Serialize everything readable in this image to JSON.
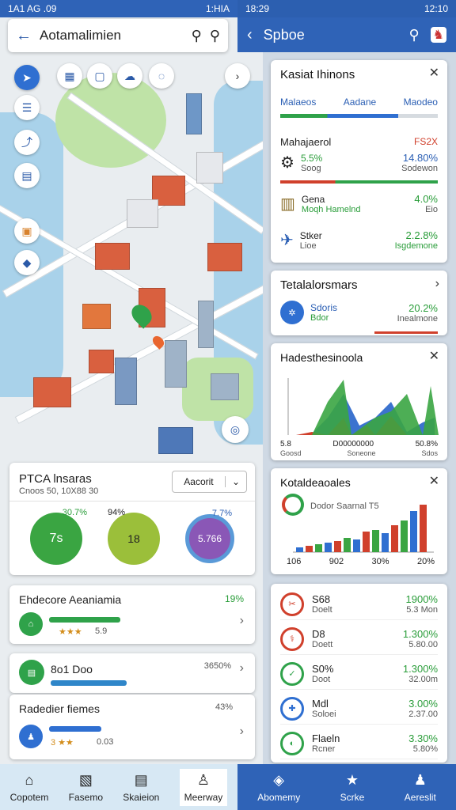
{
  "status_left": {
    "time": "1A1 AG .09",
    "right": "1:HIA"
  },
  "status_right": {
    "time": "18:29",
    "right": "12:10"
  },
  "search": {
    "title": "Aotamalimien"
  },
  "right_header": {
    "title": "Spboe"
  },
  "map_card": {
    "title": "PTCA lnsaras",
    "subtitle": "Cnoos 50, 10X88 30",
    "dropdown": "Aacorit",
    "gauges": [
      {
        "label": "30.7%",
        "value": "7s",
        "color": "#3aa542"
      },
      {
        "label": "94%",
        "value": "18",
        "color": "#9bbf3a"
      },
      {
        "label": "7.7%",
        "value": "5.766",
        "color": "#8a57b6"
      }
    ]
  },
  "list_left": [
    {
      "title": "Ehdecore Aeaniamia",
      "value": "19%",
      "rating": "★★★",
      "num": "5.9"
    },
    {
      "title": "8o1 Doo",
      "value": "3650%",
      "rating": "",
      "num": ""
    },
    {
      "title": "Radedier fiemes",
      "value": "43%",
      "rating": "3 ★★",
      "num": "0.03"
    }
  ],
  "card1": {
    "title": "Kasiat Ihinons",
    "tabs": [
      "Malaeos",
      "Aadane",
      "Maodeo"
    ],
    "header_left": "Mahajaerol",
    "header_right": "FS2X",
    "rows": [
      {
        "name": "5.5%",
        "sub": "Soog",
        "val": "14.80%",
        "val2": "Sodewon"
      },
      {
        "name": "Gena",
        "sub": "Moqh Hamelnd",
        "val": "4.0%",
        "val2": "Eio"
      },
      {
        "name": "Stker",
        "sub": "Lioe",
        "val": "2.2.8%",
        "val2": "Isgdemone"
      }
    ]
  },
  "card2": {
    "title": "Tetalalorsmars",
    "row": {
      "name": "Sdoris",
      "sub": "Bdor",
      "val": "20.2%",
      "val2": "Inealmone"
    }
  },
  "card3": {
    "title": "Hadesthesinoola",
    "labels": [
      "5.8",
      "D00000000",
      "50.8%"
    ],
    "sublabels": [
      "Goosd",
      "Soneone",
      "Sdos"
    ]
  },
  "card4": {
    "title": "Kotaldeaoales",
    "legend": "Dodor Saarnal T5",
    "labels": [
      "106",
      "902",
      "30%",
      "20%"
    ]
  },
  "metrics": [
    {
      "name": "S68",
      "sub": "Doelt",
      "val": "1900%",
      "val2": "5.3 Mon"
    },
    {
      "name": "D8",
      "sub": "Doett",
      "val": "1.300%",
      "val2": "5.80.00"
    },
    {
      "name": "S0%",
      "sub": "Doot",
      "val": "1.300%",
      "val2": "32.00m"
    },
    {
      "name": "Mdl",
      "sub": "Soloei",
      "val": "3.00%",
      "val2": "2.37.00"
    },
    {
      "name": "Flaeln",
      "sub": "Rcner",
      "val": "3.30%",
      "val2": "5.80%"
    }
  ],
  "nav_left": [
    "Copotem",
    "Fasemo",
    "Skaieion",
    "Meerway"
  ],
  "nav_right": [
    "Abomemy",
    "Scrke",
    "Aereslit"
  ]
}
